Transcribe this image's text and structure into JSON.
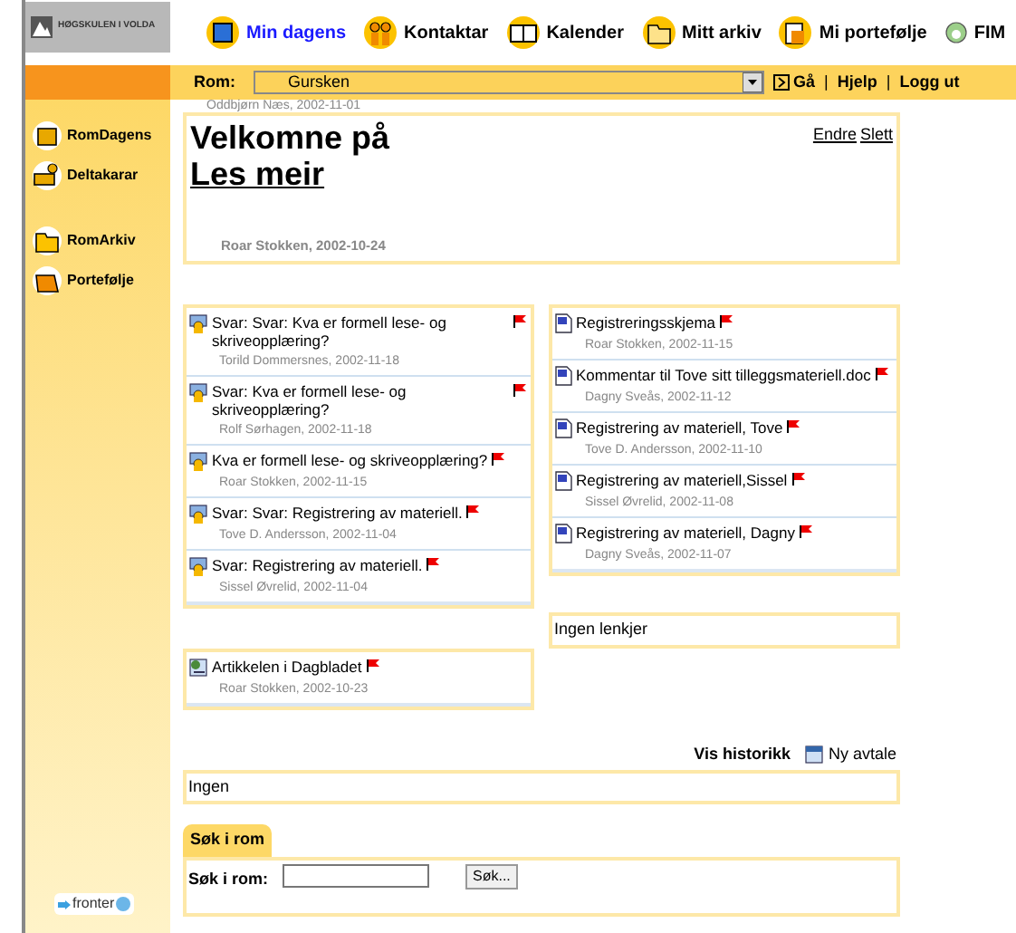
{
  "logo": {
    "text": "HØGSKULEN I VOLDA"
  },
  "nav": [
    {
      "label": "Min dagens",
      "selected": true
    },
    {
      "label": "Kontaktar",
      "selected": false
    },
    {
      "label": "Kalender",
      "selected": false
    },
    {
      "label": "Mitt arkiv",
      "selected": false
    },
    {
      "label": "Mi portefølje",
      "selected": false
    },
    {
      "label": "FIM",
      "selected": false
    }
  ],
  "room_bar": {
    "label": "Rom:",
    "room": "Gursken",
    "go": "Gå",
    "separator": "|",
    "links": [
      "Hjelp",
      "Logg ut"
    ]
  },
  "sidebar": {
    "items": [
      {
        "label": "RomDagens"
      },
      {
        "label": "Deltakarar"
      },
      {
        "label": "RomArkiv"
      },
      {
        "label": "Portefølje"
      }
    ],
    "footer": "fronter"
  },
  "announcement": {
    "previous_meta": "Oddbjørn Næs,  2002-11-01",
    "title": "Velkomne på",
    "link": "Les meir",
    "actions": [
      "Endre",
      "Slett"
    ],
    "meta": "Roar Stokken,  2002-10-24"
  },
  "discussions": [
    {
      "title": "Svar: Svar: Kva er formell lese- og skriveopplæring?",
      "meta": "Torild Dommersnes,  2002-11-18"
    },
    {
      "title": "Svar: Kva er formell lese- og skriveopplæring?",
      "meta": "Rolf Sørhagen,  2002-11-18"
    },
    {
      "title": "Kva er formell lese- og skriveopplæring?",
      "meta": "Roar Stokken,  2002-11-15"
    },
    {
      "title": "Svar: Svar: Registrering av materiell.",
      "meta": "Tove D. Andersson,  2002-11-04"
    },
    {
      "title": "Svar: Registrering av materiell.",
      "meta": "Sissel Øvrelid,  2002-11-04"
    }
  ],
  "documents": [
    {
      "title": "Registreringsskjema",
      "meta": "Roar Stokken,  2002-11-15"
    },
    {
      "title": "Kommentar til Tove sitt tilleggsmateriell.doc",
      "meta": "Dagny Sveås,  2002-11-12"
    },
    {
      "title": "Registrering av materiell, Tove",
      "meta": "Tove D. Andersson,  2002-11-10"
    },
    {
      "title": "Registrering av materiell,Sissel",
      "meta": "Sissel Øvrelid,  2002-11-08"
    },
    {
      "title": "Registrering av materiell, Dagny",
      "meta": "Dagny Sveås,  2002-11-07"
    }
  ],
  "links_box": {
    "text": "Ingen lenkjer"
  },
  "articles": [
    {
      "title": "Artikkelen i Dagbladet",
      "meta": "Roar Stokken,  2002-10-23"
    }
  ],
  "calendar": {
    "history": "Vis historikk",
    "new": "Ny avtale",
    "text": "Ingen"
  },
  "search": {
    "tab": "Søk i rom",
    "label": "Søk i rom:",
    "button": "Søk..."
  }
}
